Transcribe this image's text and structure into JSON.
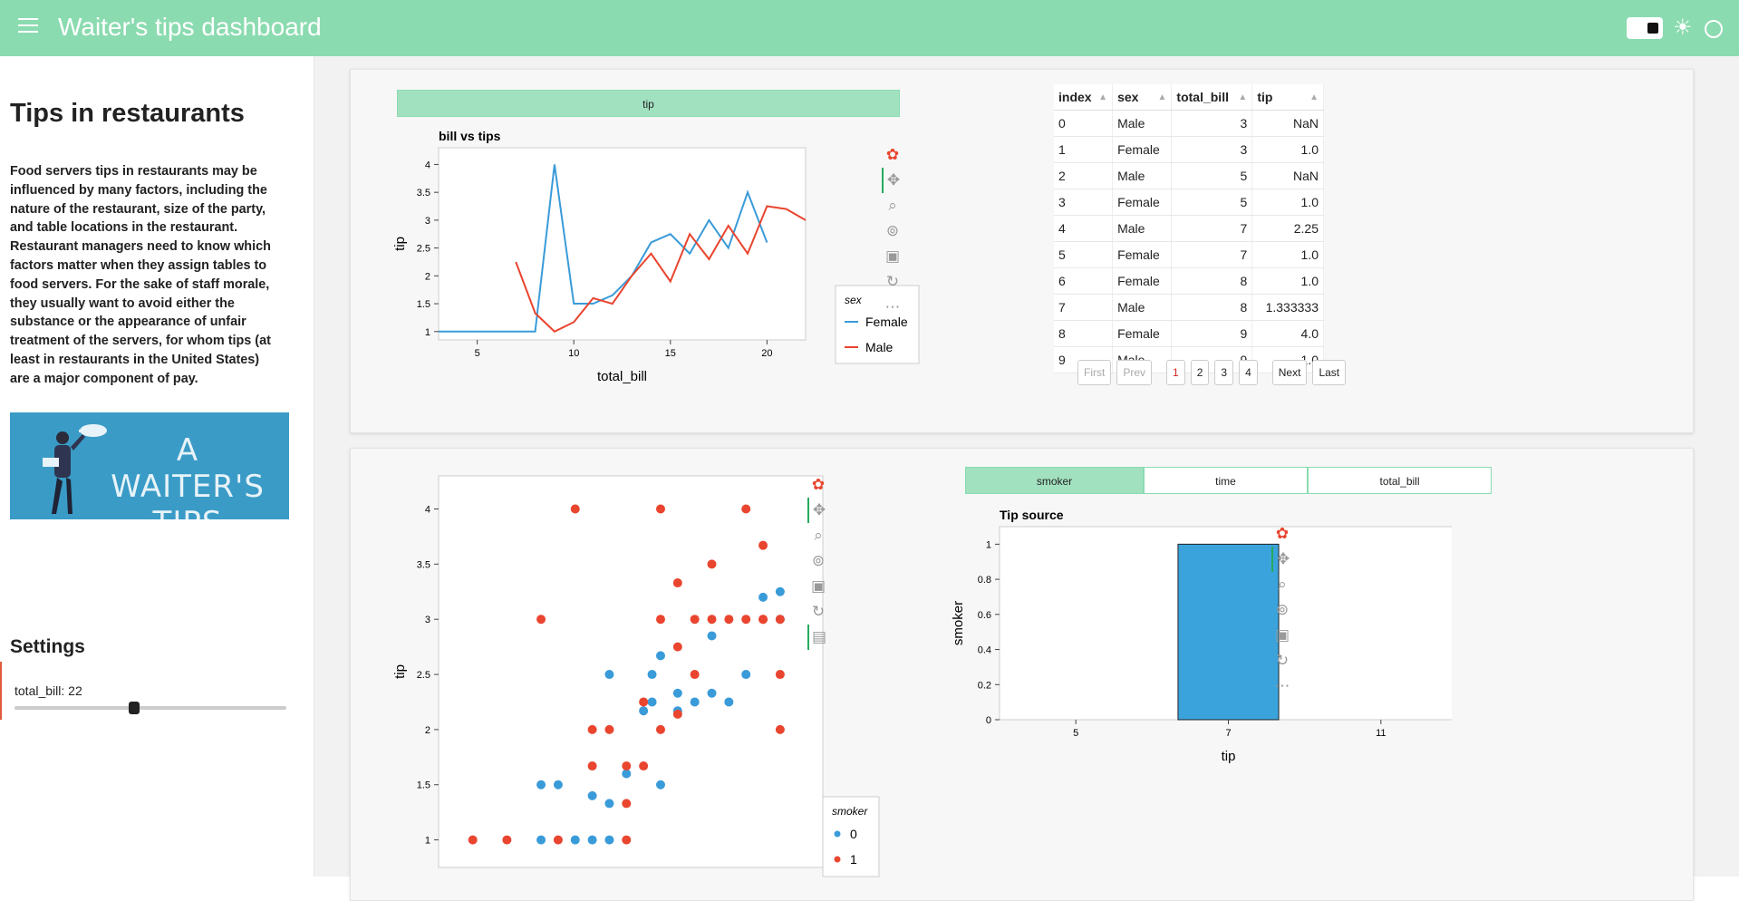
{
  "app": {
    "title": "Waiter's tips dashboard",
    "accent_color": "#8bdbb0",
    "icons": [
      "menu-icon",
      "theme-toggle-icon",
      "sun-icon",
      "circle-icon"
    ]
  },
  "sidebar": {
    "heading": "Tips in restaurants",
    "description": "Food servers tips in restaurants may be influenced by many factors, including the nature of the restaurant, size of the party, and table locations in the restaurant. Restaurant managers need to know which factors matter when they assign tables to food servers. For the sake of staff morale, they usually want to avoid either the substance or the appearance of unfair treatment of the servers, for whom tips (at least in restaurants in the United States) are a major component of pay.",
    "banner_text": "A WAITER'S TIPS",
    "settings": {
      "title": "Settings",
      "slider_label": "total_bill:",
      "slider_value": "22",
      "slider_fraction": 0.44
    }
  },
  "panel1": {
    "button_label": "tip",
    "table": {
      "columns": [
        "index",
        "sex",
        "total_bill",
        "tip"
      ],
      "rows": [
        [
          "0",
          "Male",
          "3",
          "NaN"
        ],
        [
          "1",
          "Female",
          "3",
          "1.0"
        ],
        [
          "2",
          "Male",
          "5",
          "NaN"
        ],
        [
          "3",
          "Female",
          "5",
          "1.0"
        ],
        [
          "4",
          "Male",
          "7",
          "2.25"
        ],
        [
          "5",
          "Female",
          "7",
          "1.0"
        ],
        [
          "6",
          "Female",
          "8",
          "1.0"
        ],
        [
          "7",
          "Male",
          "8",
          "1.333333"
        ],
        [
          "8",
          "Female",
          "9",
          "4.0"
        ],
        [
          "9",
          "Male",
          "9",
          "1.0"
        ]
      ],
      "pager": [
        "First",
        "Prev",
        "1",
        "2",
        "3",
        "4",
        "Next",
        "Last"
      ],
      "current_page": "1"
    }
  },
  "panel2": {
    "buttons": [
      "smoker",
      "time",
      "total_bill"
    ],
    "active_button": "smoker"
  },
  "toolbar_icons": [
    "bokeh-logo-icon",
    "pan-icon",
    "box-zoom-icon",
    "wheel-zoom-icon",
    "save-icon",
    "reset-icon",
    "more-icon"
  ],
  "chart_data": [
    {
      "type": "line",
      "title": "bill vs tips",
      "xlabel": "total_bill",
      "ylabel": "tip",
      "xlim": [
        3,
        22
      ],
      "ylim": [
        0.85,
        4.3
      ],
      "x_ticks": [
        "5",
        "10",
        "15",
        "20"
      ],
      "y_ticks": [
        "1",
        "1.5",
        "2",
        "2.5",
        "3",
        "3.5",
        "4"
      ],
      "legend_title": "sex",
      "legend_position": "bottom-right",
      "series": [
        {
          "name": "Female",
          "color": "#3a9bd9",
          "x": [
            3,
            8,
            9,
            10,
            11,
            12,
            13,
            14,
            15,
            16,
            17,
            18,
            19,
            20
          ],
          "y": [
            1,
            1,
            4,
            1.5,
            1.5,
            1.65,
            2.0,
            2.6,
            2.75,
            2.4,
            3.0,
            2.5,
            3.5,
            2.6
          ]
        },
        {
          "name": "Male",
          "color": "#e9452f",
          "x": [
            7,
            8,
            9,
            10,
            11,
            12,
            13,
            14,
            15,
            16,
            17,
            18,
            19,
            20,
            21,
            22
          ],
          "y": [
            2.25,
            1.33,
            1.0,
            1.17,
            1.6,
            1.5,
            2.0,
            2.4,
            1.9,
            2.75,
            2.3,
            2.9,
            2.4,
            3.25,
            3.2,
            3.0
          ]
        }
      ]
    },
    {
      "type": "scatter",
      "title": "",
      "xlabel": "",
      "ylabel": "tip",
      "xlim": [
        3,
        25.5
      ],
      "ylim": [
        0.75,
        4.3
      ],
      "y_ticks": [
        "1",
        "1.5",
        "2",
        "2.5",
        "3",
        "3.5",
        "4"
      ],
      "legend_title": "smoker",
      "legend_position": "bottom-right",
      "series": [
        {
          "name": "0",
          "color": "#3a9bd9",
          "points": [
            [
              9,
              1
            ],
            [
              11,
              1
            ],
            [
              12,
              1
            ],
            [
              13,
              1
            ],
            [
              9,
              1.5
            ],
            [
              10,
              1.5
            ],
            [
              12,
              1.4
            ],
            [
              13,
              1.33
            ],
            [
              14,
              1.6
            ],
            [
              13,
              2.5
            ],
            [
              15,
              2.17
            ],
            [
              15.5,
              2.25
            ],
            [
              15.5,
              2.5
            ],
            [
              16,
              2.67
            ],
            [
              17,
              2.17
            ],
            [
              17,
              2.33
            ],
            [
              18,
              2.25
            ],
            [
              19,
              2.33
            ],
            [
              19,
              2.85
            ],
            [
              20,
              2.25
            ],
            [
              21,
              2.5
            ],
            [
              16,
              1.5
            ],
            [
              22,
              3.2
            ],
            [
              23,
              3.25
            ],
            [
              23,
              3
            ]
          ]
        },
        {
          "name": "1",
          "color": "#e9452f",
          "points": [
            [
              5,
              1
            ],
            [
              7,
              1
            ],
            [
              10,
              1
            ],
            [
              14,
              1
            ],
            [
              9,
              3
            ],
            [
              11,
              4
            ],
            [
              16,
              4
            ],
            [
              21,
              4
            ],
            [
              12,
              2
            ],
            [
              13,
              2
            ],
            [
              12,
              1.67
            ],
            [
              14,
              1.67
            ],
            [
              15,
              1.67
            ],
            [
              14,
              1.33
            ],
            [
              15,
              2.25
            ],
            [
              16,
              2.0
            ],
            [
              16,
              3
            ],
            [
              17,
              2.14
            ],
            [
              17,
              2.75
            ],
            [
              17,
              3.33
            ],
            [
              18,
              2.5
            ],
            [
              18,
              3
            ],
            [
              19,
              3
            ],
            [
              20,
              3
            ],
            [
              21,
              3
            ],
            [
              19,
              3.5
            ],
            [
              22,
              3.67
            ],
            [
              22,
              3
            ],
            [
              22,
              3
            ],
            [
              23,
              3
            ],
            [
              23,
              2.5
            ],
            [
              23,
              2
            ]
          ]
        }
      ]
    },
    {
      "type": "bar",
      "title": "Tip source",
      "xlabel": "tip",
      "ylabel": "smoker",
      "categories": [
        "5",
        "7",
        "11"
      ],
      "values": [
        0,
        1,
        0
      ],
      "ylim": [
        0,
        1.1
      ],
      "y_ticks": [
        "0",
        "0.2",
        "0.4",
        "0.6",
        "0.8",
        "1"
      ],
      "color": "#3ba3dc"
    }
  ]
}
